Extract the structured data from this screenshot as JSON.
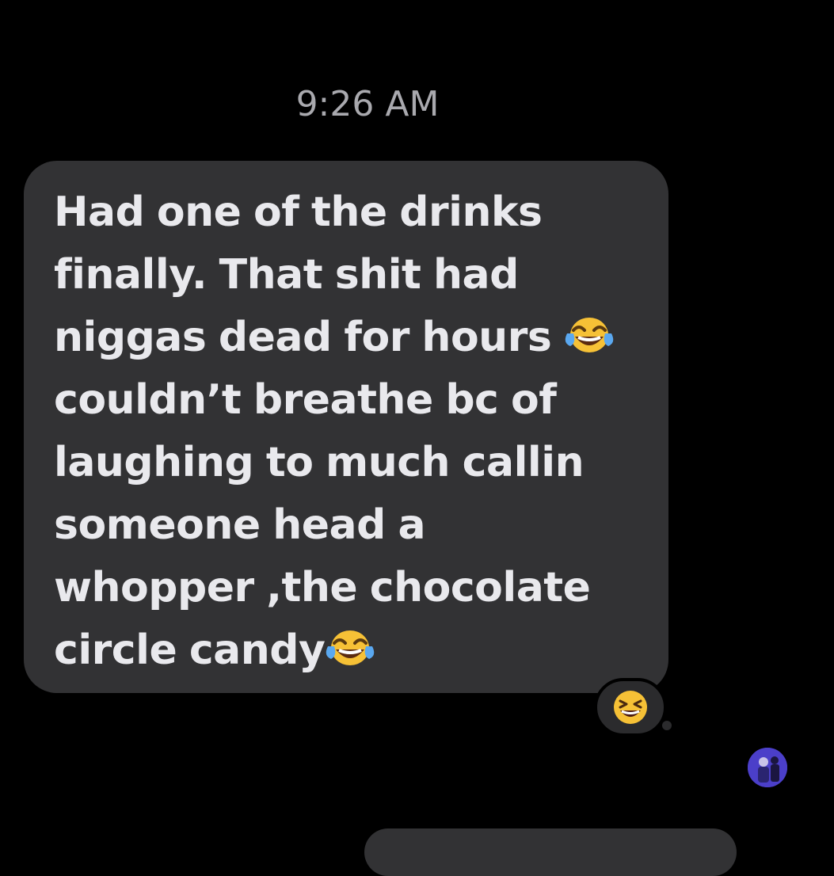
{
  "conversation": {
    "timestamp": "9:26 AM",
    "message": {
      "lines": [
        "Had one of the drinks",
        "finally.  That shit had",
        "niggas dead for hours ",
        "couldn’t breathe bc of",
        "laughing to much callin",
        "someone head a",
        "whopper ,the chocolate",
        "circle candy"
      ],
      "emoji_icons": [
        "tears-of-joy-emoji",
        "tears-of-joy-emoji"
      ]
    },
    "reaction": {
      "icon": "grinning-squinting-face-emoji"
    },
    "avatar": {
      "icon": "contact-avatar"
    }
  },
  "colors": {
    "background": "#000000",
    "bubble": "#323234",
    "text": "#e9e9ed",
    "timestamp": "#a9a9ae"
  }
}
